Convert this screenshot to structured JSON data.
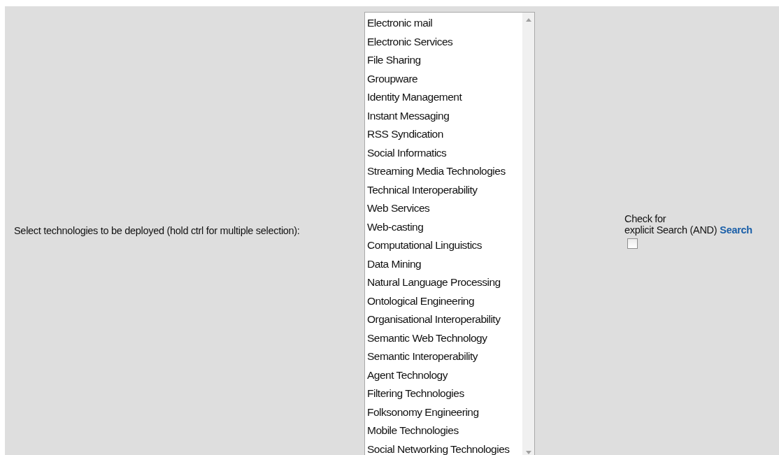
{
  "form": {
    "label": "Select technologies to be deployed (hold ctrl for multiple selection):",
    "technologies": [
      {
        "label": "Electronic mail",
        "selected": false
      },
      {
        "label": "Electronic Services",
        "selected": false
      },
      {
        "label": "File Sharing",
        "selected": false
      },
      {
        "label": "Groupware",
        "selected": false
      },
      {
        "label": "Identity Management",
        "selected": false
      },
      {
        "label": "Instant Messaging",
        "selected": false
      },
      {
        "label": "RSS Syndication",
        "selected": false
      },
      {
        "label": "Social Informatics",
        "selected": false
      },
      {
        "label": "Streaming Media Technologies",
        "selected": false
      },
      {
        "label": "Technical Interoperability",
        "selected": false
      },
      {
        "label": "Web Services",
        "selected": false
      },
      {
        "label": "Web-casting",
        "selected": false
      },
      {
        "label": "Computational Linguistics",
        "selected": false
      },
      {
        "label": "Data Mining",
        "selected": false
      },
      {
        "label": "Natural Language Processing",
        "selected": false
      },
      {
        "label": "Ontological Engineering",
        "selected": false
      },
      {
        "label": "Organisational Interoperability",
        "selected": false
      },
      {
        "label": "Semantic Web Technology",
        "selected": false
      },
      {
        "label": "Semantic Interoperability",
        "selected": false
      },
      {
        "label": "Agent Technology",
        "selected": false
      },
      {
        "label": "Filtering Technologies",
        "selected": false
      },
      {
        "label": "Folksonomy Engineering",
        "selected": false
      },
      {
        "label": "Mobile Technologies",
        "selected": false
      },
      {
        "label": "Social Networking Technologies",
        "selected": false
      }
    ],
    "explicit": {
      "label_line_1": "Check for",
      "label_line_2": "explicit Search (AND)",
      "checked": false
    },
    "search_link": "Search"
  }
}
